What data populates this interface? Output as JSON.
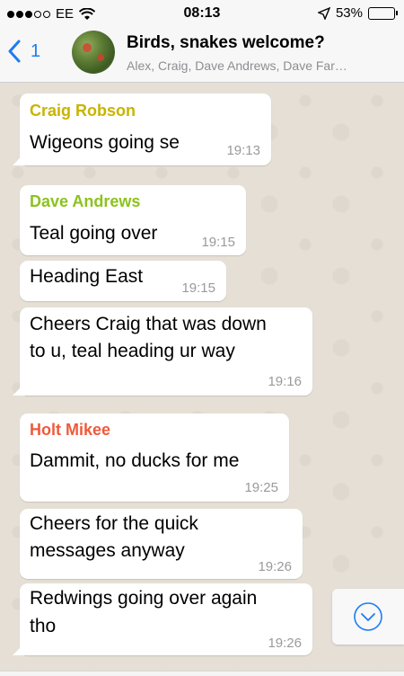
{
  "status_bar": {
    "carrier": "EE",
    "time": "08:13",
    "battery": "53%",
    "battery_level": 0.53
  },
  "header": {
    "back_count": "1",
    "title": "Birds, snakes welcome?",
    "subtitle": "Alex, Craig, Dave Andrews, Dave Far…"
  },
  "messages": [
    {
      "sender": "Craig Robson",
      "sender_color": "#c8b400",
      "lines": [
        "Wigeons going se"
      ],
      "time": "19:13"
    },
    {
      "sender": "Dave Andrews",
      "sender_color": "#8cc21f",
      "lines": [
        "Teal going over"
      ],
      "time": "19:15"
    },
    {
      "sender": "",
      "lines": [
        "Heading East"
      ],
      "time": "19:15"
    },
    {
      "sender": "",
      "lines": [
        "Cheers Craig that was down",
        "to u, teal heading ur way"
      ],
      "time": "19:16"
    },
    {
      "sender": "Holt Mikee",
      "sender_color": "#ee5a3c",
      "lines": [
        "Dammit, no ducks for me"
      ],
      "time": "19:25"
    },
    {
      "sender": "",
      "lines": [
        "Cheers for the quick",
        "messages anyway"
      ],
      "time": "19:26"
    },
    {
      "sender": "",
      "lines": [
        "Redwings going over again",
        "tho"
      ],
      "time": "19:26"
    }
  ]
}
